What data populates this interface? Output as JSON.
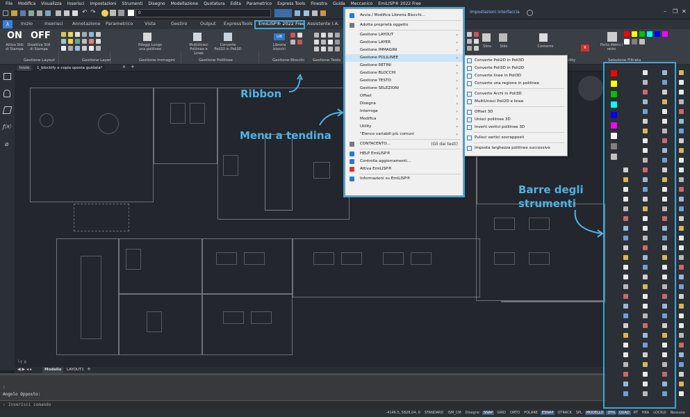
{
  "menubar": [
    "File",
    "Modifica",
    "Visualizza",
    "Inserisci",
    "Impostazioni",
    "Strumenti",
    "Disegno",
    "Modellazione",
    "Quotatura",
    "Edita",
    "Parametrico",
    "Express Tools",
    "Finestra",
    "Guida",
    "Meccanico",
    "EmiLISP® 2022 Free"
  ],
  "toolbar1": {
    "layer_value": "0",
    "interface_label": "Impostazioni interfaccia"
  },
  "tabs": [
    "Inizio",
    "Inserisci",
    "Annotazione",
    "Parametrico",
    "Vista",
    "Gestiro",
    "Output",
    "ExpressTools",
    "EmiLISP® 2022 Free",
    "Assistente I.A."
  ],
  "active_tab": "EmiLISP® 2022 Free",
  "ribbon": {
    "on_label": "ON",
    "off_label": "OFF",
    "btn_on": "Attiva Stili di Stampa",
    "btn_off": "Disattiva Stili di Stampa",
    "btn_rileggi": "Rileggi Lungo una polilinee",
    "btn_multiunisci": "MultiUnisci Polilinee e Linee",
    "btn_converte": "Converte Poli2D in Poli3D",
    "btn_libreria": "Libreria blocchi",
    "btn_stira": "Stira",
    "btn_stilo": "Stilo",
    "btn_contorno": "Contorno",
    "btn_porta": "Porta dietro i retini",
    "panels": [
      "Gestione Layout",
      "Gestione Layer",
      "Gestione Immagini",
      "Gestione Polilinee",
      "Gestione Blocchi",
      "Gestione Testo",
      "Utility",
      "Selezione Filtrata"
    ]
  },
  "doctab": {
    "start": "Inizio",
    "file": "1_blockify e copia sposta guidata*",
    "plus": "+"
  },
  "layout_tabs": {
    "model": "Modello",
    "layout1": "LAYOUT1",
    "plus": "+"
  },
  "command": {
    "line1": ":",
    "line2": "Angolo Opposto:",
    "prompt": "Inserisci comando"
  },
  "statusbar": {
    "coords": "-4146.5, 5826.04, 0",
    "items": [
      {
        "label": "STANDARD",
        "on": false
      },
      {
        "label": "ISM_CM",
        "on": false
      },
      {
        "label": "Disegno",
        "on": false
      },
      {
        "label": "SNAP",
        "on": true
      },
      {
        "label": "GRID",
        "on": false
      },
      {
        "label": "ORTO",
        "on": false
      },
      {
        "label": "POLARE",
        "on": false
      },
      {
        "label": "ESNAP",
        "on": true
      },
      {
        "label": "OTRACK",
        "on": false
      },
      {
        "label": "SPL",
        "on": false
      },
      {
        "label": "MODELLO",
        "on": true
      },
      {
        "label": "DYN",
        "on": true
      },
      {
        "label": "QUAD",
        "on": true
      },
      {
        "label": "RT",
        "on": false
      },
      {
        "label": "HKA",
        "on": false
      },
      {
        "label": "LOCKUI",
        "on": false
      },
      {
        "label": "Nessuno",
        "on": false
      }
    ]
  },
  "menu1": [
    {
      "label": "Avvia / Modifica Libreria Blocchi...",
      "arrow": false,
      "icon": "library-icon",
      "sep_after": true,
      "highlight": false
    },
    {
      "label": "Adotta proprietà oggetto",
      "arrow": false,
      "icon": "brush-icon",
      "sep_after": true,
      "highlight": false
    },
    {
      "label": "Gestione LAYOUT",
      "arrow": true,
      "icon": "",
      "sep_after": false,
      "highlight": false
    },
    {
      "label": "Gestione LAYER",
      "arrow": true,
      "icon": "",
      "sep_after": false,
      "highlight": false
    },
    {
      "label": "Gestione IMMAGINI",
      "arrow": true,
      "icon": "",
      "sep_after": false,
      "highlight": false
    },
    {
      "label": "Gestione POLILINEE",
      "arrow": true,
      "icon": "",
      "sep_after": false,
      "highlight": true
    },
    {
      "label": "Gestione RETINI",
      "arrow": true,
      "icon": "",
      "sep_after": false,
      "highlight": false
    },
    {
      "label": "Gestione BLOCCHI",
      "arrow": true,
      "icon": "",
      "sep_after": false,
      "highlight": false
    },
    {
      "label": "Gestione TESTO",
      "arrow": true,
      "icon": "",
      "sep_after": false,
      "highlight": false
    },
    {
      "label": "Gestione SELEZIONI",
      "arrow": true,
      "icon": "",
      "sep_after": false,
      "highlight": false
    },
    {
      "label": "Offset",
      "arrow": true,
      "icon": "",
      "sep_after": false,
      "highlight": false
    },
    {
      "label": "Disegna",
      "arrow": true,
      "icon": "",
      "sep_after": false,
      "highlight": false
    },
    {
      "label": "Interroga",
      "arrow": true,
      "icon": "",
      "sep_after": false,
      "highlight": false
    },
    {
      "label": "Modifica",
      "arrow": true,
      "icon": "",
      "sep_after": false,
      "highlight": false
    },
    {
      "label": "Utility",
      "arrow": true,
      "icon": "",
      "sep_after": false,
      "highlight": false
    },
    {
      "label": "\"Elenco variabili più comuni",
      "arrow": true,
      "icon": "",
      "sep_after": true,
      "highlight": false
    },
    {
      "label": "CONTACENTO...",
      "arrow": false,
      "icon": "count-icon",
      "sep_after": true,
      "highlight": false,
      "right": "(Gli dai testi)"
    },
    {
      "label": "HELP EmiLISP®",
      "arrow": false,
      "icon": "help-icon",
      "sep_after": false,
      "highlight": false
    },
    {
      "label": "Controlla aggiornamenti...",
      "arrow": false,
      "icon": "update-icon",
      "sep_after": false,
      "highlight": false
    },
    {
      "label": "Attiva EmiLISP®",
      "arrow": false,
      "icon": "activate-icon",
      "sep_after": true,
      "highlight": false
    },
    {
      "label": "Informazioni su EmiLISP®",
      "arrow": false,
      "icon": "info-icon",
      "sep_after": false,
      "highlight": false
    }
  ],
  "menu2": [
    {
      "label": "Converte Poli2D in Poli3D",
      "sep_after": false
    },
    {
      "label": "Converte Poli3D in Poli2D",
      "sep_after": false
    },
    {
      "label": "Converte linee in Poli3D",
      "sep_after": false
    },
    {
      "label": "Converte una regione in polilinee",
      "sep_after": true
    },
    {
      "label": "Converte Archi in Poli3D",
      "sep_after": false
    },
    {
      "label": "MultiUnisci Poli2D e linee",
      "sep_after": true
    },
    {
      "label": "Offset 3D",
      "sep_after": false
    },
    {
      "label": "Unisci polilinee 3D",
      "sep_after": false
    },
    {
      "label": "Inverti vertici polilinee 3D",
      "sep_after": true
    },
    {
      "label": "Pulisci vertici sovrapposti",
      "sep_after": true
    },
    {
      "label": "Imposta larghezza polilinee successive",
      "sep_after": false
    }
  ],
  "annotations": {
    "ribbon": "Ribbon",
    "menu": "Menu a tendina",
    "toolbars_1": "Barre degli",
    "toolbars_2": "strumenti"
  },
  "colors": {
    "accent": "#3aa7dd",
    "swatches": [
      "#ff0000",
      "#ffff00",
      "#00c000",
      "#00ffff",
      "#0000ff",
      "#ff00ff",
      "#ffffff",
      "#808080",
      "#c0c0c0"
    ]
  }
}
